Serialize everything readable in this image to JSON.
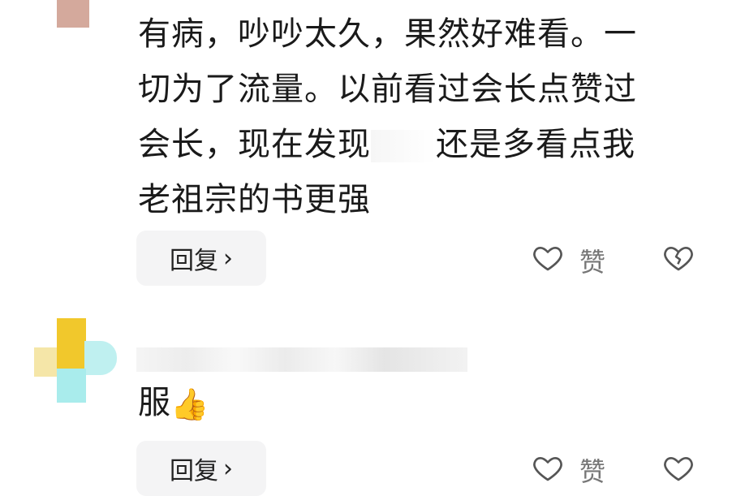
{
  "comment1": {
    "lines": [
      "有病，吵吵太久，果然好难看。一",
      "切为了流量。以前看过会长点赞过",
      "会长，现在发现",
      "还是多看点我",
      "老祖宗的书更强"
    ]
  },
  "comment2": {
    "text": "服",
    "emoji": "👍"
  },
  "actions": {
    "reply_label": "回复",
    "reply_chevron": "›",
    "like_label": "赞",
    "like_icon": "heart-outline-icon",
    "dislike_icon": "broken-heart-icon"
  }
}
